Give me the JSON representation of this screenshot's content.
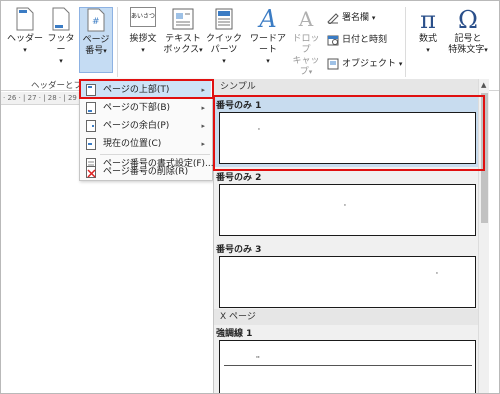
{
  "ribbon": {
    "header_label": "ヘッダー",
    "footer_label": "フッター",
    "page_number_label_1": "ページ",
    "page_number_label_2": "番号",
    "greeting_label": "挨拶文",
    "textbox_label_1": "テキスト",
    "textbox_label_2": "ボックス",
    "quickparts_label": "クイック パーツ",
    "wordart_label": "ワードアート",
    "dropcap_label_1": "ドロップ",
    "dropcap_label_2": "キャップ",
    "signature_label": "署名欄",
    "datetime_label": "日付と時刻",
    "object_label": "オブジェクト",
    "equation_label": "数式",
    "symbol_label_1": "記号と",
    "symbol_label_2": "特殊文字",
    "group_label": "ヘッダーとフッ",
    "greeting_icon_text": "あいさつ",
    "pi_symbol": "π",
    "omega_symbol": "Ω",
    "wordart_icon": "A",
    "dropcap_icon": "A",
    "dropdown_arrow": "▾"
  },
  "ruler": {
    "text": "· 26 · | 27 · | 28 · | 29 ·"
  },
  "menu": {
    "items": [
      {
        "label": "ページの上部(T)",
        "has_submenu": true
      },
      {
        "label": "ページの下部(B)",
        "has_submenu": true
      },
      {
        "label": "ページの余白(P)",
        "has_submenu": true
      },
      {
        "label": "現在の位置(C)",
        "has_submenu": true
      },
      {
        "label": "ページ番号の書式設定(F)...",
        "has_submenu": false
      },
      {
        "label": "ページ番号の削除(R)",
        "has_submenu": false
      }
    ],
    "submenu_arrow": "▸"
  },
  "gallery": {
    "header_simple": "シンプル",
    "item1": "番号のみ 1",
    "item2": "番号のみ 2",
    "item3": "番号のみ 3",
    "header_xpage": "X ページ",
    "item4": "強調線 1",
    "marker": "'",
    "marker_double": "''",
    "scroll_up": "▲"
  },
  "colors": {
    "highlight_border": "#e01010",
    "selected_bg": "#cde3f7",
    "active_button": "#c5dcf3"
  }
}
